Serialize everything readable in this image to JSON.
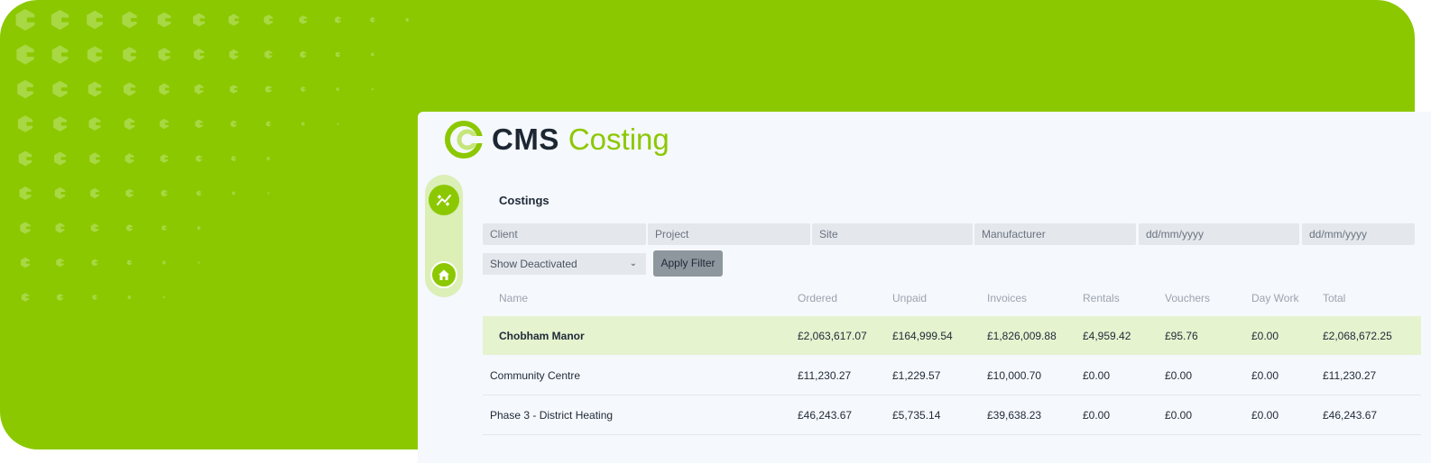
{
  "brand": {
    "name_bold": "CMS",
    "name_light": "Costing",
    "primary_color": "#8cc800",
    "dark_color": "#1d2733"
  },
  "sidebar": {
    "items": [
      {
        "icon": "sparkle-icon"
      },
      {
        "icon": "home-icon"
      }
    ]
  },
  "page": {
    "title": "Costings"
  },
  "filters": {
    "client_placeholder": "Client",
    "project_placeholder": "Project",
    "site_placeholder": "Site",
    "manufacturer_placeholder": "Manufacturer",
    "date_from_placeholder": "dd/mm/yyyy",
    "date_to_placeholder": "dd/mm/yyyy",
    "status_selected": "Show Deactivated",
    "apply_label": "Apply Filter"
  },
  "table": {
    "columns": [
      "Name",
      "Ordered",
      "Unpaid",
      "Invoices",
      "Rentals",
      "Vouchers",
      "Day Work",
      "Total"
    ],
    "rows": [
      {
        "name": "Chobham Manor",
        "ordered": "£2,063,617.07",
        "unpaid": "£164,999.54",
        "invoices": "£1,826,009.88",
        "rentals": "£4,959.42",
        "vouchers": "£95.76",
        "day_work": "£0.00",
        "total": "£2,068,672.25"
      },
      {
        "name": "Community Centre",
        "ordered": "£11,230.27",
        "unpaid": "£1,229.57",
        "invoices": "£10,000.70",
        "rentals": "£0.00",
        "vouchers": "£0.00",
        "day_work": "£0.00",
        "total": "£11,230.27"
      },
      {
        "name": "Phase 3 - District Heating",
        "ordered": "£46,243.67",
        "unpaid": "£5,735.14",
        "invoices": "£39,638.23",
        "rentals": "£0.00",
        "vouchers": "£0.00",
        "day_work": "£0.00",
        "total": "£46,243.67"
      }
    ]
  }
}
